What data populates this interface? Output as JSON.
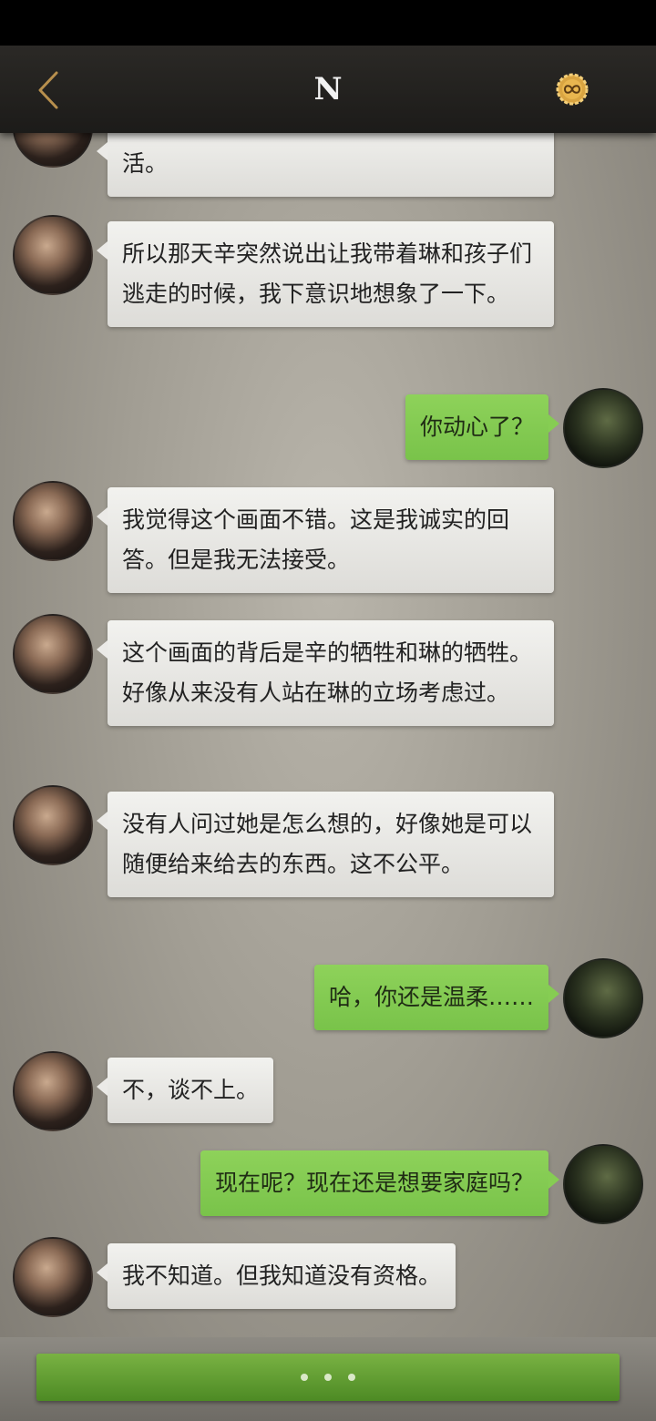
{
  "header": {
    "title": "N",
    "back_icon": "chevron-left-icon",
    "badge_icon": "infinity-gold-icon",
    "accent_color": "#b78f4d"
  },
  "messages": [
    {
      "side": "other",
      "text": "活。"
    },
    {
      "side": "other",
      "text": "所以那天辛突然说出让我带着琳和孩子们逃走的时候，我下意识地想象了一下。"
    },
    {
      "side": "self",
      "text": "你动心了？"
    },
    {
      "side": "other",
      "text": "我觉得这个画面不错。这是我诚实的回答。但是我无法接受。"
    },
    {
      "side": "other",
      "text": "这个画面的背后是辛的牺牲和琳的牺牲。好像从来没有人站在琳的立场考虑过。"
    },
    {
      "side": "other",
      "text": "没有人问过她是怎么想的，好像她是可以随便给来给去的东西。这不公平。"
    },
    {
      "side": "self",
      "text": "哈，你还是温柔……"
    },
    {
      "side": "other",
      "text": "不，谈不上。"
    },
    {
      "side": "self",
      "text": "现在呢？现在还是想要家庭吗？"
    },
    {
      "side": "other",
      "text": "我不知道。但我知道没有资格。"
    }
  ],
  "bottom_bar": {
    "button_icon": "typing-dots-icon",
    "button_color": "#5f9c30"
  }
}
